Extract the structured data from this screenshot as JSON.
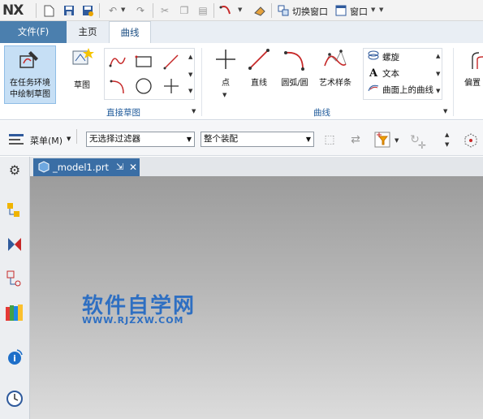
{
  "app": {
    "logo": "NX"
  },
  "quick_access": {
    "switch_window": "切换窗口",
    "window_menu": "窗口"
  },
  "tabs": [
    {
      "label": "文件(F)"
    },
    {
      "label": "主页"
    },
    {
      "label": "曲线"
    }
  ],
  "ribbon": {
    "task_env_line1": "在任务环境",
    "task_env_line2": "中绘制草图",
    "sketch_label": "草图",
    "direct_sketch_group": "直接草图",
    "point_label": "点",
    "line_label": "直线",
    "arc_label": "圆弧/圆",
    "studio_spline_label": "艺术样条",
    "curve_list": [
      {
        "label": "螺旋"
      },
      {
        "label": "文本"
      },
      {
        "label": "曲面上的曲线"
      }
    ],
    "curve_group": "曲线",
    "offset_label": "偏置"
  },
  "selection_bar": {
    "menu_label": "菜单(M)",
    "filter_value": "无选择过滤器",
    "scope_value": "整个装配"
  },
  "document": {
    "tab_name": "_model1.prt"
  },
  "watermark": {
    "cn": "软件自学网",
    "url": "WWW.RJZXW.COM"
  },
  "colors": {
    "file_tab": "#4b7fae",
    "accent_blue": "#1f5a9a",
    "highlight": "#c6dff5",
    "arrow": "#e53935"
  }
}
